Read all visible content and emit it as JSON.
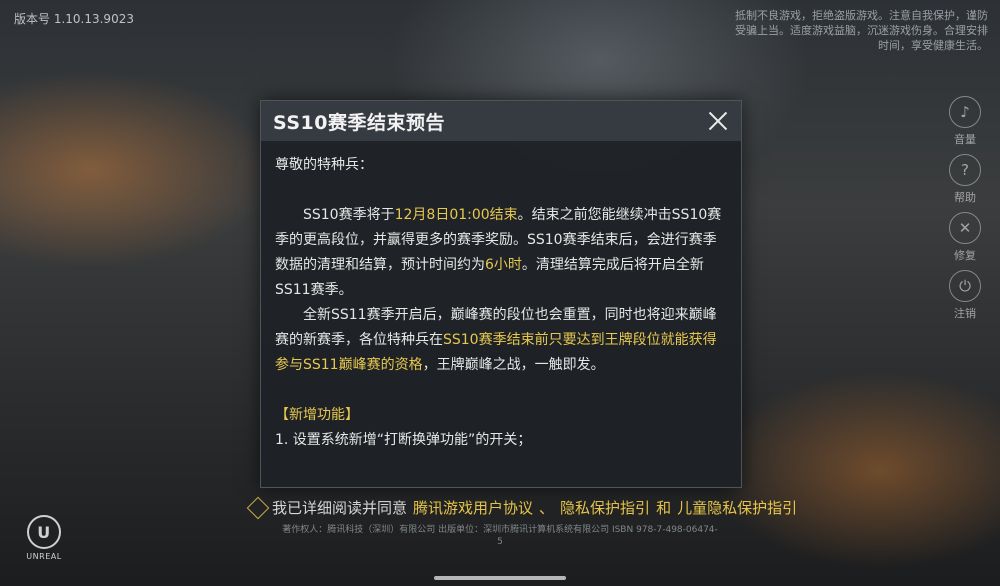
{
  "version": "版本号 1.10.13.9023",
  "legal_top": "抵制不良游戏，拒绝盗版游戏。注意自我保护，谨防受骗上当。适度游戏益脑，沉迷游戏伤身。合理安排时间，享受健康生活。",
  "side_icons": [
    {
      "icon": "speaker-icon",
      "label": "音量"
    },
    {
      "icon": "question-icon",
      "label": "帮助"
    },
    {
      "icon": "tools-icon",
      "label": "修复"
    },
    {
      "icon": "power-icon",
      "label": "注销"
    }
  ],
  "dialog": {
    "title": "SS10赛季结束预告",
    "greeting": "尊敬的特种兵：",
    "p1": {
      "a": "SS10赛季将于",
      "b": "12月8日01:00结束",
      "c": "。结束之前您能继续冲击SS10赛季的更高段位，并赢得更多的赛季奖励。SS10赛季结束后，会进行赛季数据的清理和结算，预计时间约为",
      "d": "6小时",
      "e": "。清理结算完成后将开启全新SS11赛季。"
    },
    "p2": {
      "a": "全新SS11赛季开启后，巅峰赛的段位也会重置，同时也将迎来巅峰赛的新赛季，各位特种兵在",
      "b": "SS10赛季结束前只要达到王牌段位就能获得参与SS11巅峰赛的资格",
      "c": "，王牌巅峰之战，一触即发。"
    },
    "new_features_title": "【新增功能】",
    "feature_1": "1. 设置系统新增“打断换弹功能”的开关；"
  },
  "agreement": {
    "prefix": "我已详细阅读并同意",
    "link1": "腾讯游戏用户协议",
    "sep1": "、",
    "link2": "隐私保护指引",
    "sep2": "和",
    "link3": "儿童隐私保护指引"
  },
  "ue_logo": {
    "glyph": "U",
    "text": "UNREAL"
  },
  "footer": "著作权人：腾讯科技（深圳）有限公司  出版单位：深圳市腾讯计算机系统有限公司  ISBN 978-7-498-06474-5"
}
